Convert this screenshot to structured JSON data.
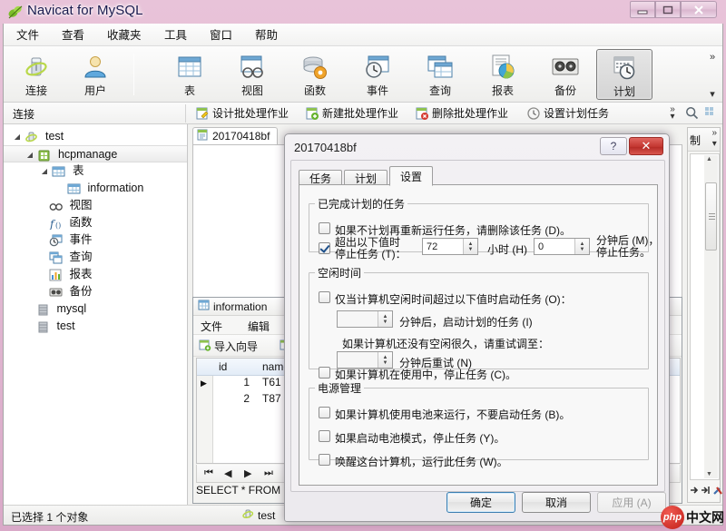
{
  "window": {
    "title": "Navicat for MySQL",
    "app_icon": "navicat-leaf-icon",
    "minimize": "–",
    "maximize": "□",
    "close": "✕"
  },
  "menubar": [
    {
      "label": "文件",
      "name": "menu-file"
    },
    {
      "label": "查看",
      "name": "menu-view"
    },
    {
      "label": "收藏夹",
      "name": "menu-favorites"
    },
    {
      "label": "工具",
      "name": "menu-tools"
    },
    {
      "label": "窗口",
      "name": "menu-window"
    },
    {
      "label": "帮助",
      "name": "menu-help"
    }
  ],
  "toolbar": {
    "overflow": "»",
    "overflow_down": "▾",
    "buttons": [
      {
        "label": "连接",
        "icon": "connection-icon",
        "selected": false
      },
      {
        "label": "用户",
        "icon": "user-icon",
        "selected": false
      },
      {
        "label": "表",
        "icon": "table-icon",
        "selected": false
      },
      {
        "label": "视图",
        "icon": "view-icon",
        "selected": false
      },
      {
        "label": "函数",
        "icon": "function-icon",
        "selected": false
      },
      {
        "label": "事件",
        "icon": "event-icon",
        "selected": false
      },
      {
        "label": "查询",
        "icon": "query-icon",
        "selected": false
      },
      {
        "label": "报表",
        "icon": "report-icon",
        "selected": false
      },
      {
        "label": "备份",
        "icon": "backup-icon",
        "selected": false
      },
      {
        "label": "计划",
        "icon": "schedule-icon",
        "selected": true
      }
    ]
  },
  "subbar": {
    "connection_label": "连接",
    "buttons": [
      {
        "label": "设计批处理作业",
        "icon": "design-batch-job-icon"
      },
      {
        "label": "新建批处理作业",
        "icon": "new-batch-job-icon"
      },
      {
        "label": "删除批处理作业",
        "icon": "delete-batch-job-icon"
      },
      {
        "label": "设置计划任务",
        "icon": "set-schedule-task-icon"
      }
    ],
    "overflow": "»",
    "overflow_down": "▾",
    "search_icon": "search-icon",
    "grid_icon": "grid-icon"
  },
  "tree": [
    {
      "label": "test",
      "icon": "connection-icon",
      "indent": 0,
      "arrow": "◢",
      "selected": false
    },
    {
      "label": "hcpmanage",
      "icon": "database-icon",
      "indent": 1,
      "arrow": "◢",
      "selected": true
    },
    {
      "label": "表",
      "icon": "table-folder-icon",
      "indent": 2,
      "arrow": "◢",
      "selected": false
    },
    {
      "label": "information",
      "icon": "table-icon",
      "indent": 4,
      "arrow": "",
      "selected": false
    },
    {
      "label": "视图",
      "icon": "view-folder-icon",
      "indent": 2,
      "arrow": "",
      "selected": false
    },
    {
      "label": "函数",
      "icon": "function-folder-icon",
      "indent": 2,
      "arrow": "",
      "selected": false
    },
    {
      "label": "事件",
      "icon": "event-folder-icon",
      "indent": 2,
      "arrow": "",
      "selected": false
    },
    {
      "label": "查询",
      "icon": "query-folder-icon",
      "indent": 2,
      "arrow": "",
      "selected": false
    },
    {
      "label": "报表",
      "icon": "report-folder-icon",
      "indent": 2,
      "arrow": "",
      "selected": false
    },
    {
      "label": "备份",
      "icon": "backup-folder-icon",
      "indent": 2,
      "arrow": "",
      "selected": false
    },
    {
      "label": "mysql",
      "icon": "database-icon",
      "indent": 1,
      "arrow": "",
      "selected": false
    },
    {
      "label": "test",
      "icon": "database-icon",
      "indent": 1,
      "arrow": "",
      "selected": false
    }
  ],
  "content": {
    "object_tab": {
      "label": "20170418bf",
      "icon": "batch-job-icon"
    },
    "table_window": {
      "title": "information",
      "title_icon": "table-icon",
      "menus": [
        {
          "label": "文件"
        },
        {
          "label": "编辑"
        }
      ],
      "tools": [
        {
          "label": "导入向导",
          "icon": "import-wizard-icon"
        },
        {
          "label": "",
          "icon": "export-wizard-icon"
        }
      ],
      "grid": {
        "columns": [
          "id",
          "name"
        ],
        "rows": [
          {
            "id": "1",
            "name": "T61",
            "current": true
          },
          {
            "id": "2",
            "name": "T87",
            "current": false
          }
        ]
      },
      "pager": [
        "⏮",
        "◀",
        "▶",
        "⏭"
      ],
      "sql_text": "SELECT * FROM"
    },
    "right_dock": {
      "label": "制",
      "overflow": "»",
      "overflow_down": "▾",
      "scroll_up": "▲",
      "scroll_down": "▼",
      "footer_icons": [
        "arrow-right-icon",
        "arrow-to-end-icon",
        "tools-icon"
      ]
    }
  },
  "statusbar": {
    "left_text": "已选择 1 个对象",
    "connection": "test",
    "connection_icon": "connection-icon"
  },
  "dialog": {
    "title": "20170418bf",
    "help_button": "?",
    "close_button": "✕",
    "tabs": [
      {
        "label": "任务",
        "active": false
      },
      {
        "label": "计划",
        "active": false
      },
      {
        "label": "设置",
        "active": true
      }
    ],
    "group_completed": {
      "legend": "已完成计划的任务",
      "delete_task_label": "如果不计划再重新运行任务，请删除该任务 (D)。",
      "delete_task_checked": false,
      "stop_label_line1": "超出以下值时",
      "stop_label_line2": "停止任务 (T)：",
      "stop_checked": true,
      "hours_value": "72",
      "hours_label": "小时 (H)",
      "minutes_value": "0",
      "minutes_label_line1": "分钟后 (M)，",
      "minutes_label_line2": "停止任务。"
    },
    "group_idle": {
      "legend": "空闲时间",
      "only_idle_label": "仅当计算机空闲时间超过以下值时启动任务 (O)：",
      "only_idle_checked": false,
      "idle_minutes_value": "",
      "idle_minutes_label": "分钟后，启动计划的任务 (I)",
      "retry_text": "如果计算机还没有空闲很久，请重试调至：",
      "retry_minutes_value": "",
      "retry_minutes_label": "分钟后重试 (N)",
      "stop_in_use_label": "如果计算机在使用中，停止任务 (C)。",
      "stop_in_use_checked": false
    },
    "group_power": {
      "legend": "电源管理",
      "items": [
        {
          "label": "如果计算机使用电池来运行，不要启动任务 (B)。",
          "checked": false
        },
        {
          "label": "如果启动电池模式，停止任务 (Y)。",
          "checked": false
        },
        {
          "label": "唤醒这台计算机，运行此任务 (W)。",
          "checked": false
        }
      ]
    },
    "footer": {
      "ok": "确定",
      "cancel": "取消",
      "apply": "应用 (A)",
      "apply_disabled": true
    }
  },
  "watermark": {
    "badge": "php",
    "text": "中文网"
  },
  "colors": {
    "accent": "#3c7fb1",
    "close_red": "#c2352f",
    "titlebar": "#e2bad3",
    "selection": "#ebebeb"
  }
}
